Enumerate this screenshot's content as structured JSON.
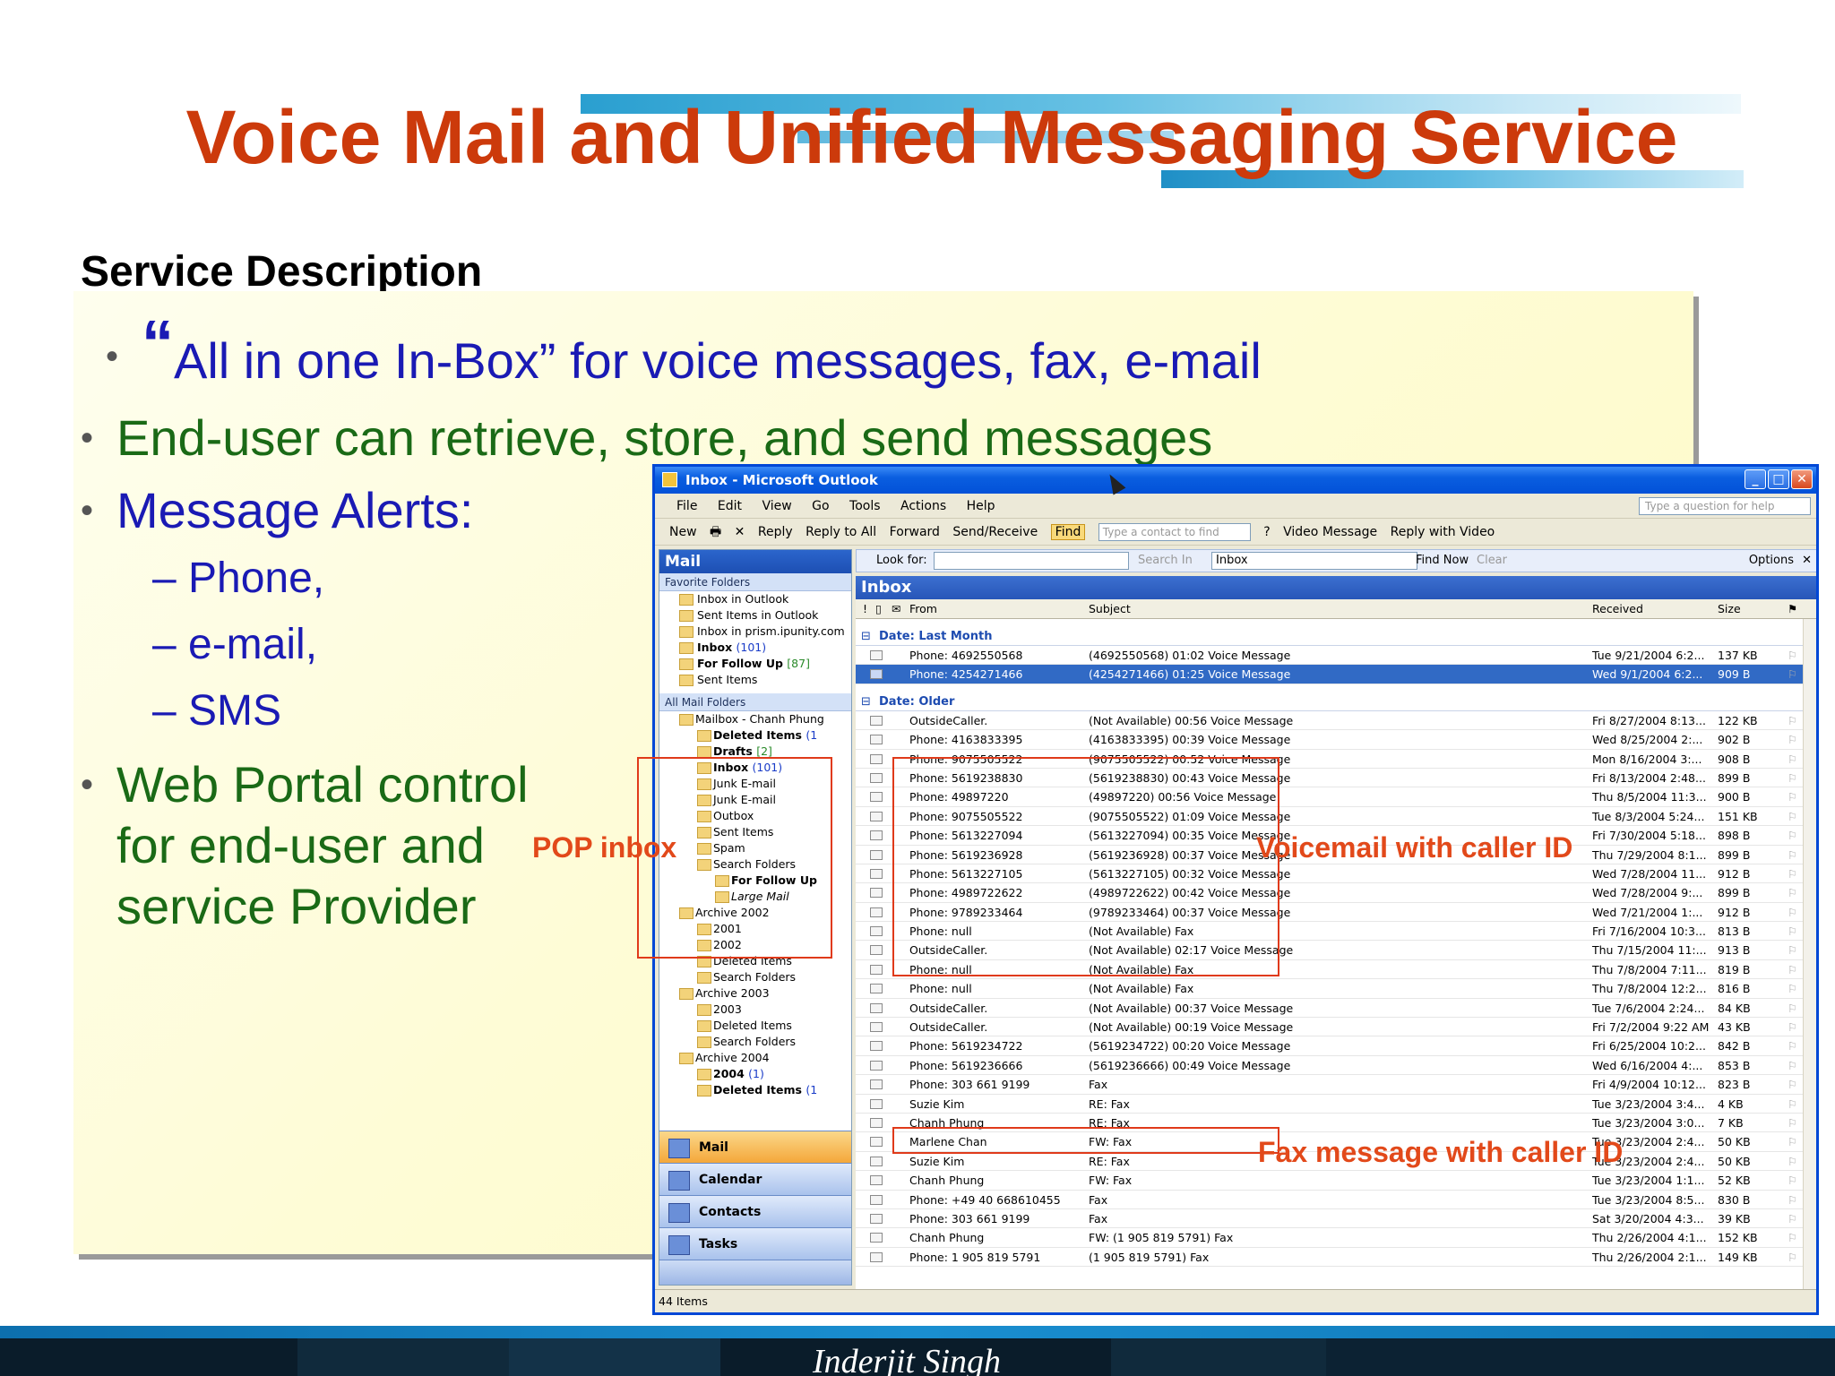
{
  "slide": {
    "title": "Voice Mail and Unified Messaging Service",
    "section_heading": "Service Description",
    "bullets": {
      "b1_quote": "“",
      "b1": "All in one In-Box” for voice messages, fax, e-mail",
      "b2": "End-user can retrieve, store, and send messages",
      "b3": "Message Alerts:",
      "sub1": "Phone,",
      "sub2": "e-mail,",
      "sub3": "SMS",
      "b4_l1": "Web Portal control",
      "b4_l2": "for end-user and",
      "b4_l3": "service Provider"
    },
    "annotations": {
      "pop": "POP inbox",
      "voicemail": "Voicemail with caller ID",
      "fax": "Fax message with caller ID"
    },
    "footer": "Inderjit Singh",
    "colors": {
      "title": "#cc3a0b",
      "blue_text": "#1a1ab4",
      "green_text": "#1a6a16",
      "annotation": "#e2491a"
    }
  },
  "outlook": {
    "window_title": "Inbox - Microsoft Outlook",
    "menu": [
      "File",
      "Edit",
      "View",
      "Go",
      "Tools",
      "Actions",
      "Help"
    ],
    "ask_placeholder": "Type a question for help",
    "toolbar": {
      "new": "New",
      "reply": "Reply",
      "reply_all": "Reply to All",
      "forward": "Forward",
      "send_receive": "Send/Receive",
      "find": "Find",
      "contact_placeholder": "Type a contact to find",
      "video_message": "Video Message",
      "reply_video": "Reply with Video"
    },
    "nav": {
      "header": "Mail",
      "favorites_label": "Favorite Folders",
      "favorites": [
        {
          "name": "Inbox in Outlook",
          "count": ""
        },
        {
          "name": "Sent Items in Outlook",
          "count": ""
        },
        {
          "name": "Inbox in prism.ipunity.com",
          "count": ""
        },
        {
          "name": "Inbox",
          "count": "(101)"
        },
        {
          "name": "For Follow Up",
          "count": "[87]"
        },
        {
          "name": "Sent Items",
          "count": ""
        }
      ],
      "all_label": "All Mail Folders",
      "folders": [
        {
          "name": "Mailbox - Chanh Phung",
          "count": ""
        },
        {
          "name": "Deleted Items",
          "count": "(1"
        },
        {
          "name": "Drafts",
          "count": "[2]"
        },
        {
          "name": "Inbox",
          "count": "(101)"
        },
        {
          "name": "Junk E-mail",
          "count": ""
        },
        {
          "name": "Junk E-mail",
          "count": ""
        },
        {
          "name": "Outbox",
          "count": ""
        },
        {
          "name": "Sent Items",
          "count": ""
        },
        {
          "name": "Spam",
          "count": ""
        },
        {
          "name": "Search Folders",
          "count": ""
        },
        {
          "name": "For Follow Up",
          "count": ""
        },
        {
          "name": "Large Mail",
          "count": ""
        },
        {
          "name": "Archive 2002",
          "count": ""
        },
        {
          "name": "2001",
          "count": ""
        },
        {
          "name": "2002",
          "count": ""
        },
        {
          "name": "Deleted Items",
          "count": ""
        },
        {
          "name": "Search Folders",
          "count": ""
        },
        {
          "name": "Archive 2003",
          "count": ""
        },
        {
          "name": "2003",
          "count": ""
        },
        {
          "name": "Deleted Items",
          "count": ""
        },
        {
          "name": "Search Folders",
          "count": ""
        },
        {
          "name": "Archive 2004",
          "count": ""
        },
        {
          "name": "2004",
          "count": "(1)"
        },
        {
          "name": "Deleted Items",
          "count": "(1"
        }
      ],
      "buttons": [
        "Mail",
        "Calendar",
        "Contacts",
        "Tasks"
      ]
    },
    "search": {
      "look_for": "Look for:",
      "search_in": "Search In",
      "search_in_value": "Inbox",
      "find_now": "Find Now",
      "clear": "Clear",
      "options": "Options"
    },
    "inbox_header": "Inbox",
    "columns": {
      "from": "From",
      "subject": "Subject",
      "received": "Received",
      "size": "Size"
    },
    "groups": {
      "last_month": "Date: Last Month",
      "older": "Date: Older"
    },
    "last_month_rows": [
      {
        "from": "Phone: 4692550568",
        "subject": "(4692550568) 01:02 Voice Message",
        "received": "Tue 9/21/2004 6:2...",
        "size": "137 KB"
      },
      {
        "from": "Phone: 4254271466",
        "subject": "(4254271466) 01:25 Voice Message",
        "received": "Wed 9/1/2004 6:2...",
        "size": "909 B"
      }
    ],
    "older_rows": [
      {
        "from": "OutsideCaller.",
        "subject": "(Not Available) 00:56 Voice Message",
        "received": "Fri 8/27/2004 8:13...",
        "size": "122 KB"
      },
      {
        "from": "Phone: 4163833395",
        "subject": "(4163833395) 00:39 Voice Message",
        "received": "Wed 8/25/2004 2:...",
        "size": "902 B"
      },
      {
        "from": "Phone: 9075505522",
        "subject": "(9075505522) 00:52 Voice Message",
        "received": "Mon 8/16/2004 3:...",
        "size": "908 B"
      },
      {
        "from": "Phone: 5619238830",
        "subject": "(5619238830) 00:43 Voice Message",
        "received": "Fri 8/13/2004 2:48...",
        "size": "899 B"
      },
      {
        "from": "Phone: 49897220",
        "subject": "(49897220) 00:56 Voice Message",
        "received": "Thu 8/5/2004 11:3...",
        "size": "900 B"
      },
      {
        "from": "Phone: 9075505522",
        "subject": "(9075505522) 01:09 Voice Message",
        "received": "Tue 8/3/2004 5:24...",
        "size": "151 KB"
      },
      {
        "from": "Phone: 5613227094",
        "subject": "(5613227094) 00:35 Voice Message",
        "received": "Fri 7/30/2004 5:18...",
        "size": "898 B"
      },
      {
        "from": "Phone: 5619236928",
        "subject": "(5619236928) 00:37 Voice Message",
        "received": "Thu 7/29/2004 8:1...",
        "size": "899 B"
      },
      {
        "from": "Phone: 5613227105",
        "subject": "(5613227105) 00:32 Voice Message",
        "received": "Wed 7/28/2004 11...",
        "size": "912 B"
      },
      {
        "from": "Phone: 4989722622",
        "subject": "(4989722622) 00:42 Voice Message",
        "received": "Wed 7/28/2004 9:...",
        "size": "899 B"
      },
      {
        "from": "Phone: 9789233464",
        "subject": "(9789233464) 00:37 Voice Message",
        "received": "Wed 7/21/2004 1:...",
        "size": "912 B"
      },
      {
        "from": "Phone: null",
        "subject": "(Not Available) Fax",
        "received": "Fri 7/16/2004 10:3...",
        "size": "813 B"
      },
      {
        "from": "OutsideCaller.",
        "subject": "(Not Available) 02:17 Voice Message",
        "received": "Thu 7/15/2004 11:...",
        "size": "913 B"
      },
      {
        "from": "Phone: null",
        "subject": "(Not Available) Fax",
        "received": "Thu 7/8/2004 7:11...",
        "size": "819 B"
      },
      {
        "from": "Phone: null",
        "subject": "(Not Available) Fax",
        "received": "Thu 7/8/2004 12:2...",
        "size": "816 B"
      },
      {
        "from": "OutsideCaller.",
        "subject": "(Not Available) 00:37 Voice Message",
        "received": "Tue 7/6/2004 2:24...",
        "size": "84 KB"
      },
      {
        "from": "OutsideCaller.",
        "subject": "(Not Available) 00:19 Voice Message",
        "received": "Fri 7/2/2004 9:22 AM",
        "size": "43 KB"
      },
      {
        "from": "Phone: 5619234722",
        "subject": "(5619234722) 00:20 Voice Message",
        "received": "Fri 6/25/2004 10:2...",
        "size": "842 B"
      },
      {
        "from": "Phone: 5619236666",
        "subject": "(5619236666) 00:49 Voice Message",
        "received": "Wed 6/16/2004 4:...",
        "size": "853 B"
      },
      {
        "from": "Phone: 303 661 9199",
        "subject": "Fax",
        "received": "Fri 4/9/2004 10:12...",
        "size": "823 B"
      },
      {
        "from": "Suzie Kim",
        "subject": "RE: Fax",
        "received": "Tue 3/23/2004 3:4...",
        "size": "4 KB"
      },
      {
        "from": "Chanh Phung",
        "subject": "RE: Fax",
        "received": "Tue 3/23/2004 3:0...",
        "size": "7 KB"
      },
      {
        "from": "Marlene Chan",
        "subject": "FW: Fax",
        "received": "Tue 3/23/2004 2:4...",
        "size": "50 KB"
      },
      {
        "from": "Suzie Kim",
        "subject": "RE: Fax",
        "received": "Tue 3/23/2004 2:4...",
        "size": "50 KB"
      },
      {
        "from": "Chanh Phung",
        "subject": "FW: Fax",
        "received": "Tue 3/23/2004 1:1...",
        "size": "52 KB"
      },
      {
        "from": "Phone: +49 40 668610455",
        "subject": "Fax",
        "received": "Tue 3/23/2004 8:5...",
        "size": "830 B"
      },
      {
        "from": "Phone: 303 661 9199",
        "subject": "Fax",
        "received": "Sat 3/20/2004 4:3...",
        "size": "39 KB"
      },
      {
        "from": "Chanh Phung",
        "subject": "FW: (1 905 819 5791) Fax",
        "received": "Thu 2/26/2004 4:1...",
        "size": "152 KB"
      },
      {
        "from": "Phone: 1 905 819 5791",
        "subject": "(1 905 819 5791) Fax",
        "received": "Thu 2/26/2004 2:1...",
        "size": "149 KB"
      }
    ],
    "status": "44 Items"
  }
}
